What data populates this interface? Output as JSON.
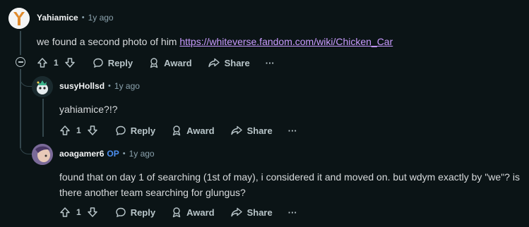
{
  "comments": [
    {
      "username": "Yahiamice",
      "time": "1y ago",
      "body_prefix": "we found a second photo of him ",
      "link": "https://whiteverse.fandom.com/wiki/Chicken_Car",
      "votes": "1"
    },
    {
      "username": "susyHollsd",
      "time": "1y ago",
      "body": "yahiamice?!?",
      "votes": "1"
    },
    {
      "username": "aoagamer6",
      "op_badge": "OP",
      "time": "1y ago",
      "body_line1": "found that on day 1 of searching (1st of may), i considered it and moved on. but wdym exactly by \"we\"? is",
      "body_line2": "there another team searching for glungus?",
      "votes": "1"
    }
  ],
  "actions": {
    "reply": "Reply",
    "award": "Award",
    "share": "Share",
    "more": "···"
  },
  "separator": "•",
  "colors": {
    "background": "#0b1416",
    "link": "#c99bff",
    "op": "#4c8ff0",
    "muted": "#8ba2ad"
  }
}
